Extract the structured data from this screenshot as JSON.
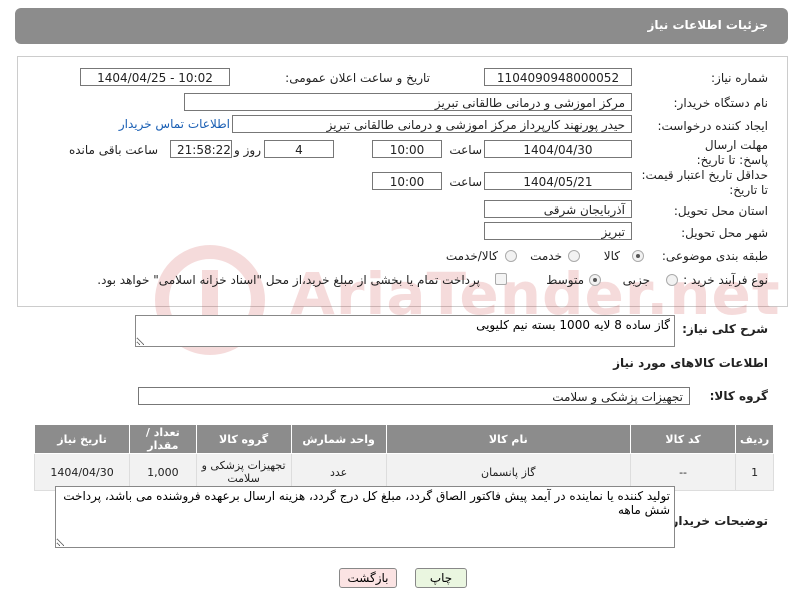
{
  "header": {
    "title": "جزئیات اطلاعات نیاز"
  },
  "form": {
    "need_number_label": "شماره نیاز:",
    "need_number": "1104090948000052",
    "announce_label": "تاریخ و ساعت اعلان عمومی:",
    "announce_value": "1404/04/25 - 10:02",
    "buyer_org_label": "نام دستگاه خریدار:",
    "buyer_org": "مرکز اموزشی و درمانی طالقانی تبریز",
    "requester_label": "ایجاد کننده درخواست:",
    "requester": "حیدر پورنهند کارپرداز مرکز اموزشی و درمانی طالقانی تبریز",
    "contact_link": "اطلاعات تماس خریدار",
    "reply_deadline_label": "مهلت ارسال پاسخ: تا تاریخ:",
    "reply_date": "1404/04/30",
    "time_label": "ساعت",
    "reply_time": "10:00",
    "day_label": "روز و",
    "days": "4",
    "remaining_time": "21:58:22",
    "remaining_label": "ساعت باقی مانده",
    "price_validity_label": "حداقل تاریخ اعتبار قیمت: تا تاریخ:",
    "validity_date": "1404/05/21",
    "validity_time": "10:00",
    "province_label": "استان محل تحویل:",
    "province": "آذربایجان شرقی",
    "city_label": "شهر محل تحویل:",
    "city": "تبریز",
    "category_label": "طبقه بندی موضوعی:",
    "category_options": [
      "کالا",
      "خدمت",
      "کالا/خدمت"
    ],
    "category_selected": "کالا",
    "process_label": "نوع فرآیند خرید :",
    "process_options": [
      "جزیی",
      "متوسط"
    ],
    "process_selected": "متوسط",
    "payment_note": "پرداخت تمام یا بخشی از مبلغ خرید،از محل \"اسناد خزانه اسلامی\" خواهد بود."
  },
  "description": {
    "label": "شرح کلی نیاز:",
    "value": "گاز ساده 8 لایه 1000 بسته نیم کلیویی"
  },
  "goods": {
    "section_title": "اطلاعات کالاهای مورد نیاز",
    "group_label": "گروه کالا:",
    "group_value": "تجهیزات پزشکی و سلامت",
    "columns": [
      "ردیف",
      "کد کالا",
      "نام کالا",
      "واحد شمارش",
      "گروه کالا",
      "تعداد / مقدار",
      "تاریخ نیاز"
    ],
    "rows": [
      [
        "1",
        "--",
        "گاز پانسمان",
        "عدد",
        "تجهیزات پزشکی و سلامت",
        "1,000",
        "1404/04/30"
      ]
    ]
  },
  "buyer_notes": {
    "label": "توضیحات خریدار:",
    "value": "تولید کننده یا نماینده در آیمد پیش فاکتور الصاق گردد، مبلغ کل درج گردد، هزینه ارسال برعهده فروشنده می باشد، پرداخت شش ماهه"
  },
  "buttons": {
    "print": "چاپ",
    "back": "بازگشت"
  },
  "watermark": {
    "text": "AriaTender.net"
  },
  "colors": {
    "header_bg": "#8c8c8c",
    "back_button_bg": "#fbe3e3",
    "print_button_bg": "#eaf6e0",
    "link": "#1a5fb4"
  }
}
